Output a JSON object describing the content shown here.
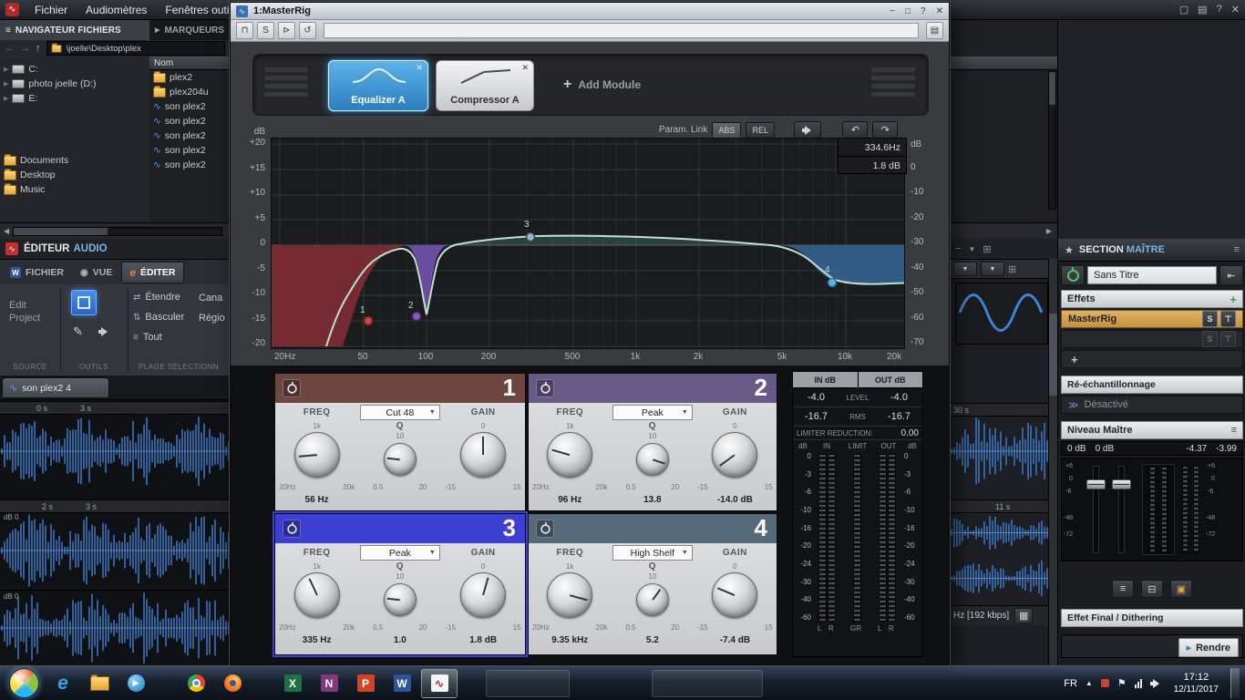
{
  "icons": {
    "grip": "≡",
    "flag_tab": "▶",
    "nav_back": "←",
    "nav_forward": "→",
    "nav_up": "↑",
    "tree_expand": "▶",
    "scroll_left": "◀",
    "scroll_right": "▶",
    "scroll_up": "▲",
    "dropdown_down": "▼",
    "win_expand": "▢",
    "win_layout": "▤",
    "win_help": "?",
    "win_close": "✕",
    "win_min": "−",
    "maximize": "□",
    "bypass": "⊓",
    "solo": "S",
    "compare": "⊳",
    "reset": "↺",
    "preset_menu": "▤",
    "close": "✕",
    "add": "+",
    "undo": "↶",
    "redo": "↷",
    "eye": "◉",
    "pencil": "✎",
    "extend": "⇄",
    "toggle": "⇅",
    "list": "≡",
    "wave": "∿",
    "star": "★",
    "menu": "≡",
    "chevrons": "≫",
    "go_start": "⇤",
    "slot_solo": "S",
    "slot_bypass": "⊤",
    "grid": "⊞",
    "link": "⊟",
    "lock": "▣",
    "render": "▸",
    "tray_flag": "⚑",
    "tray_up": "▲",
    "gear": "▦",
    "w_badge": "W",
    "e_badge": "e"
  },
  "menubar": {
    "items": [
      "Fichier",
      "Audiomètres",
      "Fenêtres outils"
    ]
  },
  "file_browser": {
    "tab_files": "NAVIGATEUR FICHIERS",
    "tab_markers": "MARQUEURS",
    "path": "\\joelle\\Desktop\\plex",
    "tree": [
      {
        "label": "C:"
      },
      {
        "label": "photo joelle (D:)"
      },
      {
        "label": "E:"
      }
    ],
    "folders": [
      {
        "label": "Documents"
      },
      {
        "label": "Desktop"
      },
      {
        "label": "Music"
      }
    ],
    "list_header": "Nom",
    "files": [
      {
        "name": "plex2",
        "type": "folder"
      },
      {
        "name": "plex204u",
        "type": "folder"
      },
      {
        "name": "son plex2",
        "type": "audio"
      },
      {
        "name": "son plex2",
        "type": "audio"
      },
      {
        "name": "son plex2",
        "type": "audio"
      },
      {
        "name": "son plex2",
        "type": "audio"
      },
      {
        "name": "son plex2",
        "type": "audio"
      }
    ]
  },
  "masterig": {
    "title": "1:MasterRig",
    "tabs": [
      {
        "label": "Equalizer A"
      },
      {
        "label": "Compressor A"
      }
    ],
    "add_module": "Add Module",
    "param_link": "Param. Link",
    "abs": "ABS",
    "rel": "REL",
    "readout_freq": "334.6Hz",
    "readout_gain": "1.8 dB",
    "graph": {
      "left_unit": "dB",
      "left_scale": [
        "+20",
        "+15",
        "+10",
        "+5",
        "0",
        "-5",
        "-10",
        "-15",
        "-20"
      ],
      "right_unit": "dB",
      "right_scale": [
        "0",
        "-10",
        "-20",
        "-30",
        "-40",
        "-50",
        "-60",
        "-70"
      ],
      "freq_scale": [
        "20Hz",
        "50",
        "100",
        "200",
        "500",
        "1k",
        "2k",
        "5k",
        "10k",
        "20k"
      ],
      "point_labels": [
        "1",
        "2",
        "3",
        "4"
      ]
    },
    "band_labels": {
      "freq": "FREQ",
      "freq_top": "1k",
      "freq_min": "20Hz",
      "freq_max": "20k",
      "q": "Q",
      "q_top": "10",
      "q_min": "0.5",
      "q_max": "20",
      "gain": "GAIN",
      "gain_top": "0",
      "gain_min": "-15",
      "gain_max": "15"
    },
    "bands": [
      {
        "number": "1",
        "type": "Cut 48",
        "freq_value": "56 Hz",
        "q_value": "",
        "gain_value": ""
      },
      {
        "number": "2",
        "type": "Peak",
        "freq_value": "96 Hz",
        "q_value": "13.8",
        "gain_value": "-14.0 dB"
      },
      {
        "number": "3",
        "type": "Peak",
        "freq_value": "335 Hz",
        "q_value": "1.0",
        "gain_value": "1.8 dB"
      },
      {
        "number": "4",
        "type": "High Shelf",
        "freq_value": "9.35 kHz",
        "q_value": "5.2",
        "gain_value": "-7.4 dB"
      }
    ],
    "meter": {
      "in_header": "IN dB",
      "out_header": "OUT dB",
      "level_label": "LEVEL",
      "in_level": "-4.0",
      "out_level": "-4.0",
      "rms_label": "RMS",
      "in_rms": "-16.7",
      "out_rms": "-16.7",
      "limiter_label": "LIMITER REDUCTION:",
      "limiter_value": "0.00",
      "col_headers": [
        "dB",
        "IN",
        "LIMIT",
        "OUT",
        "dB"
      ],
      "scale": [
        "0",
        "-3",
        "-6",
        "-10",
        "-16",
        "-20",
        "-24",
        "-30",
        "-40",
        "-60"
      ],
      "bottom_labels": [
        "L",
        "R",
        "GR",
        "L",
        "R"
      ]
    }
  },
  "editor": {
    "title_main": "ÉDITEUR",
    "title_accent": "AUDIO",
    "tabs": [
      {
        "label": "FICHIER"
      },
      {
        "label": "VUE"
      },
      {
        "label": "ÉDITER"
      }
    ],
    "edit_project": "Edit Project",
    "groups": [
      "SOURCE",
      "OUTILS",
      "PLAGE SÉLECTIONN"
    ],
    "action_extend": "Étendre",
    "action_toggle": "Basculer",
    "action_all": "Tout",
    "col_channels": "Cana",
    "col_regions": "Régio",
    "wave_tab": "son plex2 4",
    "ruler1": [
      "0 s",
      "3 s"
    ],
    "ruler1_right": "30 s",
    "ruler2": [
      "2 s",
      "3 s"
    ],
    "ruler2_right": "11 s",
    "db_zero": "dB 0",
    "status_right": "Hz [192 kbps]"
  },
  "master_section": {
    "title_main": "SECTION",
    "title_accent": "MAÎTRE",
    "preset": "Sans Titre",
    "effects_label": "Effets",
    "slot1": "MasterRig",
    "resample_label": "Ré-échantillonnage",
    "disabled_label": "Désactivé",
    "level_label": "Niveau Maître",
    "level_values": [
      "0 dB",
      "0 dB",
      "-4.37",
      "-3.99"
    ],
    "fader_scale": [
      "+6",
      "0",
      "-6",
      "-48",
      "-72"
    ],
    "final_label": "Effet Final / Dithering",
    "render_label": "Rendre"
  },
  "taskbar": {
    "tray_lang": "FR",
    "time": "17:12",
    "date": "12/11/2017"
  }
}
